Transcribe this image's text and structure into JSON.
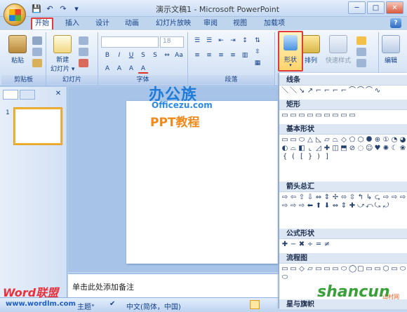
{
  "window": {
    "title": "演示文稿1 - Microsoft PowerPoint"
  },
  "qat": {
    "save": "💾",
    "undo": "↶",
    "redo": "↷",
    "more": "▾"
  },
  "window_controls": {
    "minimize": "─",
    "maximize": "□",
    "close": "✕"
  },
  "tabs": [
    "开始",
    "插入",
    "设计",
    "动画",
    "幻灯片放映",
    "审阅",
    "视图",
    "加载项"
  ],
  "help_label": "?",
  "ribbon": {
    "clipboard": {
      "paste": "粘贴",
      "label": "剪贴板"
    },
    "slides": {
      "new_slide_line1": "新建",
      "new_slide_line2": "幻灯片 ▾",
      "label": "幻灯片"
    },
    "font": {
      "font_size": "18",
      "label": "字体"
    },
    "paragraph": {
      "label": "段落"
    },
    "drawing": {
      "shape": "形状",
      "arrange": "排列",
      "quick_styles": "快速样式"
    },
    "editing": {
      "label": "编辑"
    }
  },
  "thumbnails": {
    "slide_number": "1",
    "close": "✕"
  },
  "watermark": {
    "line1": "办公族",
    "line2": "Officezu.com",
    "line3": "PPT教程"
  },
  "notes": {
    "placeholder": "单击此处添加备注"
  },
  "status": {
    "theme": "主题\"",
    "language": "中文(简体，中国)"
  },
  "brand_bottom_left": {
    "logo": "Word联盟",
    "url": "www.wordlm.com"
  },
  "brand_bottom_right": {
    "logo": "shancun",
    "sub": "山村网"
  },
  "gallery": {
    "sections": [
      {
        "title": "线条",
        "shapes": [
          "＼",
          "＼",
          "↘",
          "↗",
          "⌐",
          "⌐",
          "⌐",
          "⌐",
          "⌒",
          "⌒",
          "⌒",
          "∿"
        ]
      },
      {
        "title": "矩形",
        "shapes": [
          "▭",
          "▭",
          "▭",
          "▭",
          "▭",
          "▭",
          "▭",
          "▭",
          "▭"
        ]
      },
      {
        "title": "基本形状",
        "shapes": [
          "▭",
          "▭",
          "⬭",
          "△",
          "◺",
          "▱",
          "⏢",
          "◇",
          "⬠",
          "⬡",
          "⯃",
          "⊕",
          "①",
          "◔",
          "◕",
          "◐",
          "⌓",
          "◧",
          "⌞",
          "◿",
          "✚",
          "◫",
          "⬒",
          "⊘",
          "◌",
          "☺",
          "♥",
          "✺",
          "☾",
          "❀",
          "{",
          "(",
          "[",
          "}",
          ")",
          "]"
        ]
      },
      {
        "title": "箭头总汇",
        "shapes": [
          "⇨",
          "⇦",
          "⇧",
          "⇩",
          "⇔",
          "⇕",
          "✢",
          "⬄",
          "⇳",
          "↰",
          "↳",
          "⮎",
          "⇨",
          "⇨",
          "⇨",
          "⇨",
          "⇨",
          "⇨",
          "⬅",
          "⬆",
          "⬇",
          "⇔",
          "⇕",
          "✚",
          "⤻",
          "⤺",
          "⤿",
          "⤾"
        ]
      },
      {
        "title": "公式形状",
        "shapes": [
          "✚",
          "−",
          "✖",
          "÷",
          "═",
          "≠"
        ]
      },
      {
        "title": "流程图",
        "shapes": [
          "▭",
          "▭",
          "◇",
          "▱",
          "▭",
          "▭",
          "▭",
          "⬭",
          "◯",
          "▢",
          "▭",
          "▭",
          "⬡",
          "▭",
          "⬭",
          "⬭"
        ]
      },
      {
        "title": "星与旗帜",
        "shapes": []
      }
    ]
  }
}
